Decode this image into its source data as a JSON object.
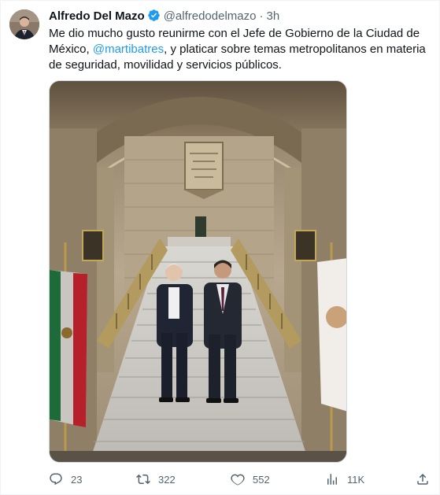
{
  "tweet": {
    "display_name": "Alfredo Del Mazo",
    "handle": "@alfredodelmazo",
    "separator": "·",
    "time": "3h",
    "text_before": "Me dio mucho gusto reunirme con el Jefe de Gobierno de la Ciudad de México, ",
    "mention": "@martibatres",
    "text_after": ", y platicar sobre temas metropolitanos en materia de seguridad, movilidad y servicios públicos.",
    "media_plaque": "GOBERNAR A LA CIUDAD ES SERVIRLA"
  },
  "actions": {
    "replies": "23",
    "retweets": "322",
    "likes": "552",
    "views": "11K"
  },
  "icons": [
    "verified-badge-icon",
    "reply-icon",
    "retweet-icon",
    "like-icon",
    "views-icon",
    "share-icon"
  ],
  "colors": {
    "accent": "#1d9bf0",
    "text": "#0f1419",
    "muted": "#536471"
  }
}
